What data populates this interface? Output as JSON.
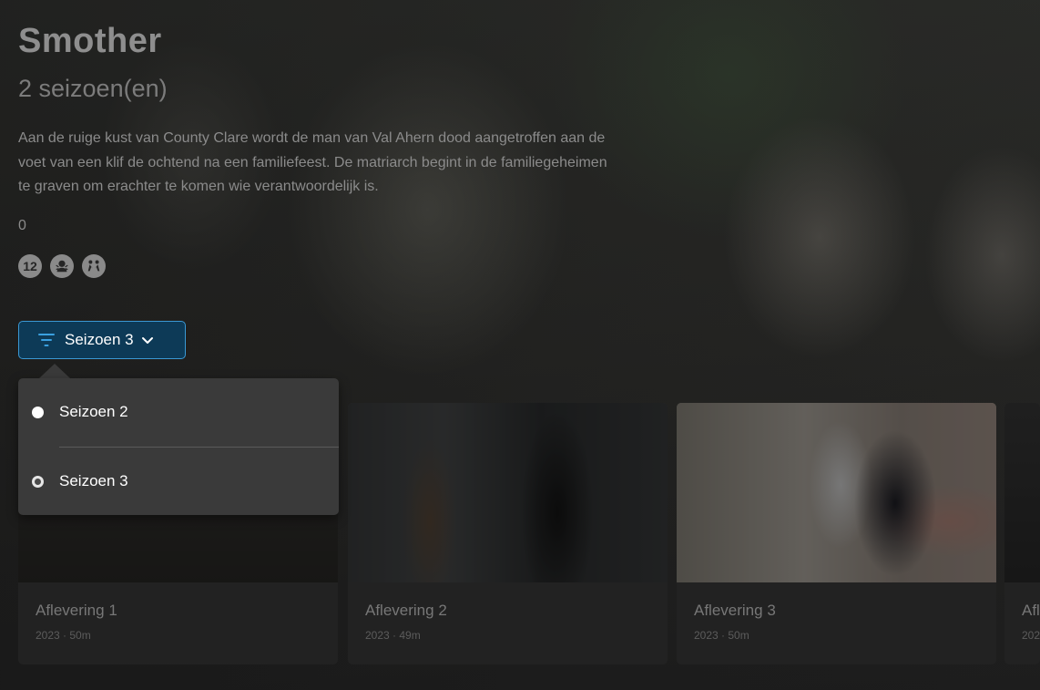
{
  "show": {
    "title": "Smother",
    "seasons_count": "2 seizoen(en)",
    "synopsis": "Aan de ruige kust van County Clare wordt de man van Val Ahern dood aangetroffen aan de voet van een klif de ochtend na een familiefeest. De matriarch begint in de familiegeheimen te graven om erachter te komen wie verantwoordelijk is.",
    "rating": "0",
    "badges": [
      {
        "name": "age-12-icon",
        "label": "12"
      },
      {
        "name": "fear-icon",
        "label": ""
      },
      {
        "name": "violence-icon",
        "label": ""
      }
    ]
  },
  "season_selector": {
    "label": "Seizoen 3",
    "options": [
      {
        "label": "Seizoen 2",
        "selected": false
      },
      {
        "label": "Seizoen 3",
        "selected": true
      }
    ]
  },
  "episodes": [
    {
      "title": "Aflevering 1",
      "meta": "2023 · 50m"
    },
    {
      "title": "Aflevering 2",
      "meta": "2023 · 49m"
    },
    {
      "title": "Aflevering 3",
      "meta": "2023 · 50m"
    },
    {
      "title": "Afl",
      "meta": "202"
    }
  ],
  "colors": {
    "accent": "#3a98d4",
    "button_bg": "#0d3a57",
    "dropdown_bg": "#3a3a3a"
  }
}
